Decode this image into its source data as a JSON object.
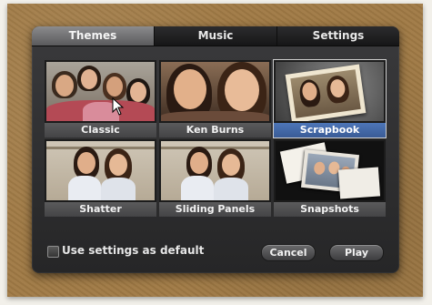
{
  "tabs": [
    {
      "label": "Themes",
      "active": true
    },
    {
      "label": "Music",
      "active": false
    },
    {
      "label": "Settings",
      "active": false
    }
  ],
  "themes": [
    {
      "label": "Classic",
      "selected": false
    },
    {
      "label": "Ken Burns",
      "selected": false
    },
    {
      "label": "Scrapbook",
      "selected": true
    },
    {
      "label": "Shatter",
      "selected": false
    },
    {
      "label": "Sliding Panels",
      "selected": false
    },
    {
      "label": "Snapshots",
      "selected": false
    }
  ],
  "footer": {
    "checkbox_label": "Use settings as default",
    "checkbox_checked": false,
    "cancel_label": "Cancel",
    "play_label": "Play"
  },
  "colors": {
    "selected_label": "#3f63a3",
    "dialog_background": "#2f2f31"
  }
}
